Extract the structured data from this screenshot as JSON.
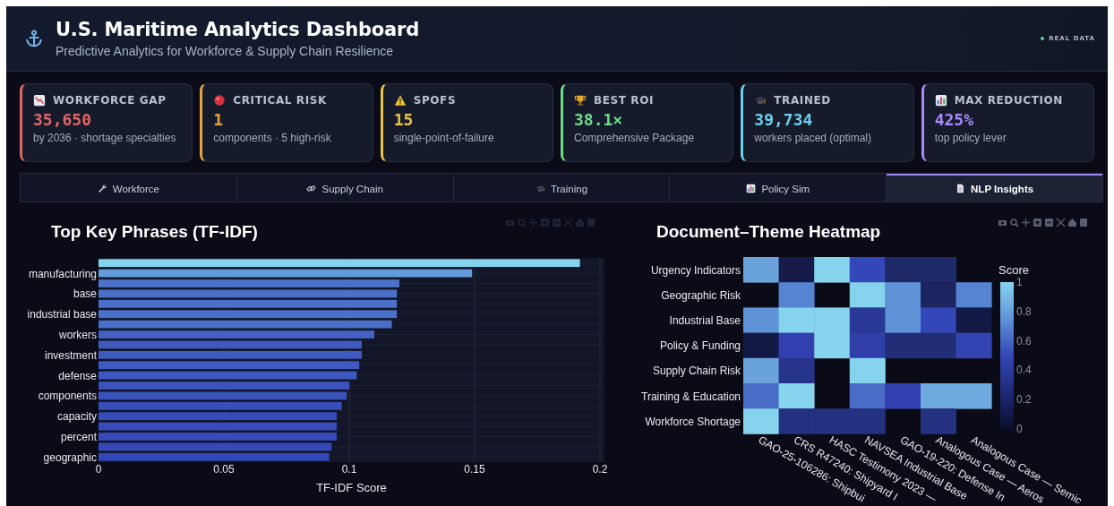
{
  "header": {
    "title": "U.S. Maritime Analytics Dashboard",
    "subtitle": "Predictive Analytics for Workforce & Supply Chain Resilience",
    "status": "REAL DATA"
  },
  "cards": [
    {
      "label": "WORKFORCE GAP",
      "value": "35,650",
      "note": "by 2036 · shortage specialties",
      "color": "#e06666"
    },
    {
      "label": "CRITICAL RISK",
      "value": "1",
      "note": "components · 5 high-risk",
      "color": "#e8a33d"
    },
    {
      "label": "SPOFS",
      "value": "15",
      "note": "single-point-of-failure",
      "color": "#e8c547"
    },
    {
      "label": "BEST ROI",
      "value": "38.1×",
      "note": "Comprehensive Package",
      "color": "#6ddc8a"
    },
    {
      "label": "TRAINED",
      "value": "39,734",
      "note": "workers placed (optimal)",
      "color": "#6ccfef"
    },
    {
      "label": "MAX REDUCTION",
      "value": "425%",
      "note": "top policy lever",
      "color": "#a78bfa"
    }
  ],
  "tabs": [
    {
      "label": "Workforce",
      "selected": false
    },
    {
      "label": "Supply Chain",
      "selected": false
    },
    {
      "label": "Training",
      "selected": false
    },
    {
      "label": "Policy Sim",
      "selected": false
    },
    {
      "label": "NLP Insights",
      "selected": true
    }
  ],
  "phrases_chart": {
    "chart_data": {
      "type": "bar",
      "orientation": "h",
      "grid": true,
      "title": "Top Key Phrases (TF-IDF)",
      "xlabel": "TF-IDF Score",
      "xlim": [
        0,
        0.2
      ],
      "xticks": [
        0,
        0.05,
        0.1,
        0.15,
        0.2
      ],
      "categories": [
        null,
        "manufacturing",
        null,
        "base",
        null,
        "industrial base",
        null,
        "workers",
        null,
        "investment",
        null,
        "defense",
        null,
        "components",
        null,
        "capacity",
        null,
        "percent",
        null,
        "geographic"
      ],
      "values": [
        0.192,
        0.149,
        0.12,
        0.119,
        0.119,
        0.119,
        0.117,
        0.11,
        0.105,
        0.105,
        0.104,
        0.103,
        0.1,
        0.099,
        0.097,
        0.095,
        0.095,
        0.095,
        0.093,
        0.092
      ]
    }
  },
  "heatmap": {
    "title": "Document–Theme Heatmap",
    "colorbar": {
      "title": "Score",
      "ticks": [
        "1",
        "0.8",
        "0.6",
        "0.4",
        "0.2",
        "0"
      ]
    },
    "columns": [
      "GAO-25-106286: Shipbui",
      "CRS R47240: Shipyard I",
      "HASC Testimony 2023 —",
      "NAVSEA Industrial Base",
      "GAO-19-220: Defense In",
      "Analogous Case — Aeros",
      "Analogous Case — Semic"
    ],
    "rows": [
      {
        "label": "Urgency Indicators",
        "cells": [
          {
            "filled": true,
            "color": "#6aa3dc"
          },
          {
            "filled": true,
            "color": "#161b4a"
          },
          {
            "filled": true,
            "color": "#86d3ee"
          },
          {
            "filled": true,
            "color": "#3447b8"
          },
          {
            "filled": true,
            "color": "#1f2a68"
          },
          {
            "filled": true,
            "color": "#1f2a68"
          },
          {
            "filled": false
          }
        ]
      },
      {
        "label": "Geographic Risk",
        "cells": [
          {
            "filled": false
          },
          {
            "filled": true,
            "color": "#5484d2"
          },
          {
            "filled": false
          },
          {
            "filled": true,
            "color": "#86d3ee"
          },
          {
            "filled": true,
            "color": "#5f93d8"
          },
          {
            "filled": true,
            "color": "#1c255f"
          },
          {
            "filled": true,
            "color": "#5484d2"
          }
        ]
      },
      {
        "label": "Industrial Base",
        "cells": [
          {
            "filled": true,
            "color": "#5f93d8"
          },
          {
            "filled": true,
            "color": "#86d3ee"
          },
          {
            "filled": true,
            "color": "#86d3ee"
          },
          {
            "filled": true,
            "color": "#2a3896"
          },
          {
            "filled": true,
            "color": "#5f93d8"
          },
          {
            "filled": true,
            "color": "#3447b8"
          },
          {
            "filled": true,
            "color": "#141a46"
          }
        ]
      },
      {
        "label": "Policy & Funding",
        "cells": [
          {
            "filled": true,
            "color": "#141a46"
          },
          {
            "filled": true,
            "color": "#3140ae"
          },
          {
            "filled": true,
            "color": "#86d3ee"
          },
          {
            "filled": true,
            "color": "#2f3ea8"
          },
          {
            "filled": true,
            "color": "#222d78"
          },
          {
            "filled": true,
            "color": "#222d78"
          },
          {
            "filled": true,
            "color": "#3443b2"
          }
        ]
      },
      {
        "label": "Supply Chain Risk",
        "cells": [
          {
            "filled": true,
            "color": "#6aa3dc"
          },
          {
            "filled": true,
            "color": "#27348c"
          },
          {
            "filled": false
          },
          {
            "filled": true,
            "color": "#86d3ee"
          },
          {
            "filled": false
          },
          {
            "filled": false
          },
          {
            "filled": false
          }
        ]
      },
      {
        "label": "Training & Education",
        "cells": [
          {
            "filled": true,
            "color": "#4a6dc8"
          },
          {
            "filled": true,
            "color": "#86d3ee"
          },
          {
            "filled": false
          },
          {
            "filled": true,
            "color": "#4a6dc8"
          },
          {
            "filled": true,
            "color": "#3140ae"
          },
          {
            "filled": true,
            "color": "#6eaae0"
          },
          {
            "filled": true,
            "color": "#6eaae0"
          }
        ]
      },
      {
        "label": "Workforce Shortage",
        "cells": [
          {
            "filled": true,
            "color": "#86d3ee"
          },
          {
            "filled": true,
            "color": "#243080"
          },
          {
            "filled": true,
            "color": "#243080"
          },
          {
            "filled": true,
            "color": "#243080"
          },
          {
            "filled": false
          },
          {
            "filled": true,
            "color": "#243080"
          },
          {
            "filled": false
          }
        ]
      }
    ]
  }
}
